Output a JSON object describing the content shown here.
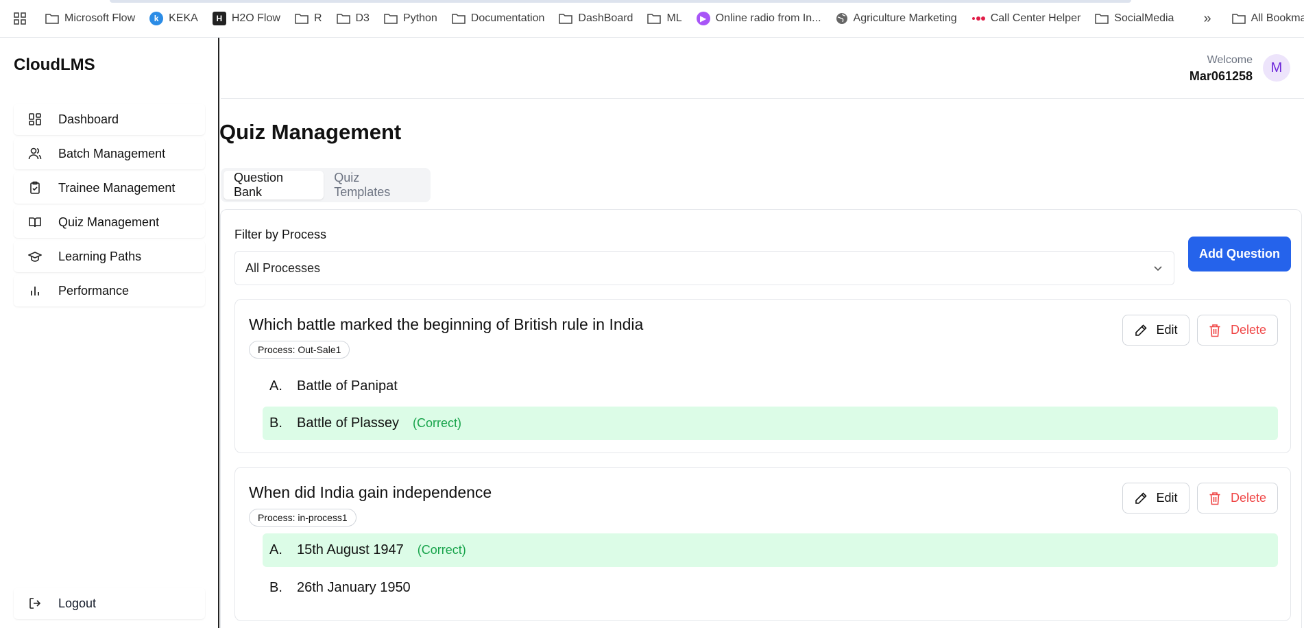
{
  "bookmarks": {
    "items": [
      {
        "label": "Microsoft Flow",
        "icon": "folder-icon"
      },
      {
        "label": "KEKA",
        "icon": "keka-logo-icon"
      },
      {
        "label": "H2O Flow",
        "icon": "h2o-logo-icon"
      },
      {
        "label": "R",
        "icon": "folder-icon"
      },
      {
        "label": "D3",
        "icon": "folder-icon"
      },
      {
        "label": "Python",
        "icon": "folder-icon"
      },
      {
        "label": "Documentation",
        "icon": "folder-icon"
      },
      {
        "label": "DashBoard",
        "icon": "folder-icon"
      },
      {
        "label": "ML",
        "icon": "folder-icon"
      },
      {
        "label": "Online radio from In...",
        "icon": "radio-play-icon"
      },
      {
        "label": "Agriculture Marketing",
        "icon": "globe-icon"
      },
      {
        "label": "Call Center Helper",
        "icon": "dots-logo-icon"
      },
      {
        "label": "SocialMedia",
        "icon": "folder-icon"
      }
    ],
    "more": "»",
    "all_bookmarks": "All Bookmarks"
  },
  "sidebar": {
    "brand": "CloudLMS",
    "items": [
      {
        "label": "Dashboard",
        "icon": "grid-icon"
      },
      {
        "label": "Batch Management",
        "icon": "users-icon"
      },
      {
        "label": "Trainee Management",
        "icon": "clipboard-check-icon"
      },
      {
        "label": "Quiz Management",
        "icon": "book-open-icon"
      },
      {
        "label": "Learning Paths",
        "icon": "graduation-cap-icon"
      },
      {
        "label": "Performance",
        "icon": "bar-chart-icon"
      }
    ],
    "logout": "Logout"
  },
  "header": {
    "welcome": "Welcome",
    "username": "Mar061258",
    "avatar_initial": "M"
  },
  "main": {
    "title": "Quiz Management",
    "tabs": [
      {
        "label": "Question Bank",
        "active": true
      },
      {
        "label": "Quiz Templates",
        "active": false
      }
    ],
    "filter_label": "Filter by Process",
    "filter_value": "All Processes",
    "add_button": "Add Question",
    "edit_label": "Edit",
    "delete_label": "Delete",
    "correct_tag": "(Correct)",
    "questions": [
      {
        "title": "Which battle marked the beginning of British rule in India",
        "process": "Process: Out-Sale1",
        "options": [
          {
            "letter": "A.",
            "text": "Battle of Panipat",
            "correct": false
          },
          {
            "letter": "B.",
            "text": "Battle of Plassey",
            "correct": true
          }
        ]
      },
      {
        "title": "When did India gain independence",
        "process": "Process: in-process1",
        "options": [
          {
            "letter": "A.",
            "text": "15th August 1947",
            "correct": true
          },
          {
            "letter": "B.",
            "text": "26th January 1950",
            "correct": false
          }
        ]
      }
    ]
  },
  "colors": {
    "accent": "#2563eb",
    "correct_bg": "#dcfce7",
    "correct_text": "#16a34a",
    "danger": "#ef4444",
    "avatar_bg": "#ede4fb"
  }
}
